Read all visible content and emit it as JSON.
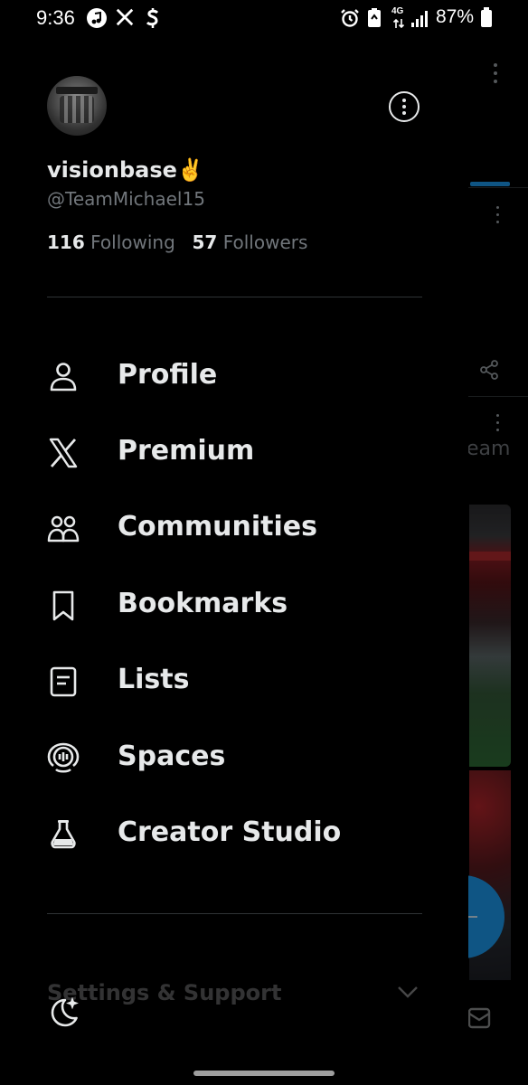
{
  "status_bar": {
    "time": "9:36",
    "network": "4G",
    "battery": "87%"
  },
  "account": {
    "display_name": "visionbase✌️",
    "handle": "@TeamMichael15",
    "following_count": "116",
    "following_label": "Following",
    "followers_count": "57",
    "followers_label": "Followers"
  },
  "menu": {
    "items": [
      {
        "label": "Profile",
        "icon": "person-icon"
      },
      {
        "label": "Premium",
        "icon": "x-logo-icon"
      },
      {
        "label": "Communities",
        "icon": "communities-icon"
      },
      {
        "label": "Bookmarks",
        "icon": "bookmark-icon"
      },
      {
        "label": "Lists",
        "icon": "list-icon"
      },
      {
        "label": "Spaces",
        "icon": "spaces-icon"
      },
      {
        "label": "Creator Studio",
        "icon": "flask-icon"
      }
    ]
  },
  "settings": {
    "label": "Settings & Support"
  },
  "background": {
    "partial_text": "eam"
  },
  "colors": {
    "background": "#000000",
    "text_primary": "#e7e9ea",
    "text_secondary": "#71767b",
    "divider": "#2f3336",
    "accent": "#1d9bf0"
  }
}
